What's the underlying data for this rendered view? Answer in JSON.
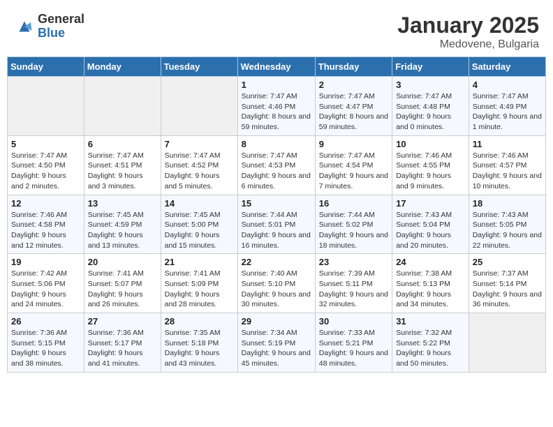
{
  "logo": {
    "general": "General",
    "blue": "Blue"
  },
  "title": "January 2025",
  "location": "Medovene, Bulgaria",
  "days_header": [
    "Sunday",
    "Monday",
    "Tuesday",
    "Wednesday",
    "Thursday",
    "Friday",
    "Saturday"
  ],
  "weeks": [
    [
      {
        "day": "",
        "sunrise": "",
        "sunset": "",
        "daylight": ""
      },
      {
        "day": "",
        "sunrise": "",
        "sunset": "",
        "daylight": ""
      },
      {
        "day": "",
        "sunrise": "",
        "sunset": "",
        "daylight": ""
      },
      {
        "day": "1",
        "sunrise": "Sunrise: 7:47 AM",
        "sunset": "Sunset: 4:46 PM",
        "daylight": "Daylight: 8 hours and 59 minutes."
      },
      {
        "day": "2",
        "sunrise": "Sunrise: 7:47 AM",
        "sunset": "Sunset: 4:47 PM",
        "daylight": "Daylight: 8 hours and 59 minutes."
      },
      {
        "day": "3",
        "sunrise": "Sunrise: 7:47 AM",
        "sunset": "Sunset: 4:48 PM",
        "daylight": "Daylight: 9 hours and 0 minutes."
      },
      {
        "day": "4",
        "sunrise": "Sunrise: 7:47 AM",
        "sunset": "Sunset: 4:49 PM",
        "daylight": "Daylight: 9 hours and 1 minute."
      }
    ],
    [
      {
        "day": "5",
        "sunrise": "Sunrise: 7:47 AM",
        "sunset": "Sunset: 4:50 PM",
        "daylight": "Daylight: 9 hours and 2 minutes."
      },
      {
        "day": "6",
        "sunrise": "Sunrise: 7:47 AM",
        "sunset": "Sunset: 4:51 PM",
        "daylight": "Daylight: 9 hours and 3 minutes."
      },
      {
        "day": "7",
        "sunrise": "Sunrise: 7:47 AM",
        "sunset": "Sunset: 4:52 PM",
        "daylight": "Daylight: 9 hours and 5 minutes."
      },
      {
        "day": "8",
        "sunrise": "Sunrise: 7:47 AM",
        "sunset": "Sunset: 4:53 PM",
        "daylight": "Daylight: 9 hours and 6 minutes."
      },
      {
        "day": "9",
        "sunrise": "Sunrise: 7:47 AM",
        "sunset": "Sunset: 4:54 PM",
        "daylight": "Daylight: 9 hours and 7 minutes."
      },
      {
        "day": "10",
        "sunrise": "Sunrise: 7:46 AM",
        "sunset": "Sunset: 4:55 PM",
        "daylight": "Daylight: 9 hours and 9 minutes."
      },
      {
        "day": "11",
        "sunrise": "Sunrise: 7:46 AM",
        "sunset": "Sunset: 4:57 PM",
        "daylight": "Daylight: 9 hours and 10 minutes."
      }
    ],
    [
      {
        "day": "12",
        "sunrise": "Sunrise: 7:46 AM",
        "sunset": "Sunset: 4:58 PM",
        "daylight": "Daylight: 9 hours and 12 minutes."
      },
      {
        "day": "13",
        "sunrise": "Sunrise: 7:45 AM",
        "sunset": "Sunset: 4:59 PM",
        "daylight": "Daylight: 9 hours and 13 minutes."
      },
      {
        "day": "14",
        "sunrise": "Sunrise: 7:45 AM",
        "sunset": "Sunset: 5:00 PM",
        "daylight": "Daylight: 9 hours and 15 minutes."
      },
      {
        "day": "15",
        "sunrise": "Sunrise: 7:44 AM",
        "sunset": "Sunset: 5:01 PM",
        "daylight": "Daylight: 9 hours and 16 minutes."
      },
      {
        "day": "16",
        "sunrise": "Sunrise: 7:44 AM",
        "sunset": "Sunset: 5:02 PM",
        "daylight": "Daylight: 9 hours and 18 minutes."
      },
      {
        "day": "17",
        "sunrise": "Sunrise: 7:43 AM",
        "sunset": "Sunset: 5:04 PM",
        "daylight": "Daylight: 9 hours and 20 minutes."
      },
      {
        "day": "18",
        "sunrise": "Sunrise: 7:43 AM",
        "sunset": "Sunset: 5:05 PM",
        "daylight": "Daylight: 9 hours and 22 minutes."
      }
    ],
    [
      {
        "day": "19",
        "sunrise": "Sunrise: 7:42 AM",
        "sunset": "Sunset: 5:06 PM",
        "daylight": "Daylight: 9 hours and 24 minutes."
      },
      {
        "day": "20",
        "sunrise": "Sunrise: 7:41 AM",
        "sunset": "Sunset: 5:07 PM",
        "daylight": "Daylight: 9 hours and 26 minutes."
      },
      {
        "day": "21",
        "sunrise": "Sunrise: 7:41 AM",
        "sunset": "Sunset: 5:09 PM",
        "daylight": "Daylight: 9 hours and 28 minutes."
      },
      {
        "day": "22",
        "sunrise": "Sunrise: 7:40 AM",
        "sunset": "Sunset: 5:10 PM",
        "daylight": "Daylight: 9 hours and 30 minutes."
      },
      {
        "day": "23",
        "sunrise": "Sunrise: 7:39 AM",
        "sunset": "Sunset: 5:11 PM",
        "daylight": "Daylight: 9 hours and 32 minutes."
      },
      {
        "day": "24",
        "sunrise": "Sunrise: 7:38 AM",
        "sunset": "Sunset: 5:13 PM",
        "daylight": "Daylight: 9 hours and 34 minutes."
      },
      {
        "day": "25",
        "sunrise": "Sunrise: 7:37 AM",
        "sunset": "Sunset: 5:14 PM",
        "daylight": "Daylight: 9 hours and 36 minutes."
      }
    ],
    [
      {
        "day": "26",
        "sunrise": "Sunrise: 7:36 AM",
        "sunset": "Sunset: 5:15 PM",
        "daylight": "Daylight: 9 hours and 38 minutes."
      },
      {
        "day": "27",
        "sunrise": "Sunrise: 7:36 AM",
        "sunset": "Sunset: 5:17 PM",
        "daylight": "Daylight: 9 hours and 41 minutes."
      },
      {
        "day": "28",
        "sunrise": "Sunrise: 7:35 AM",
        "sunset": "Sunset: 5:18 PM",
        "daylight": "Daylight: 9 hours and 43 minutes."
      },
      {
        "day": "29",
        "sunrise": "Sunrise: 7:34 AM",
        "sunset": "Sunset: 5:19 PM",
        "daylight": "Daylight: 9 hours and 45 minutes."
      },
      {
        "day": "30",
        "sunrise": "Sunrise: 7:33 AM",
        "sunset": "Sunset: 5:21 PM",
        "daylight": "Daylight: 9 hours and 48 minutes."
      },
      {
        "day": "31",
        "sunrise": "Sunrise: 7:32 AM",
        "sunset": "Sunset: 5:22 PM",
        "daylight": "Daylight: 9 hours and 50 minutes."
      },
      {
        "day": "",
        "sunrise": "",
        "sunset": "",
        "daylight": ""
      }
    ]
  ]
}
